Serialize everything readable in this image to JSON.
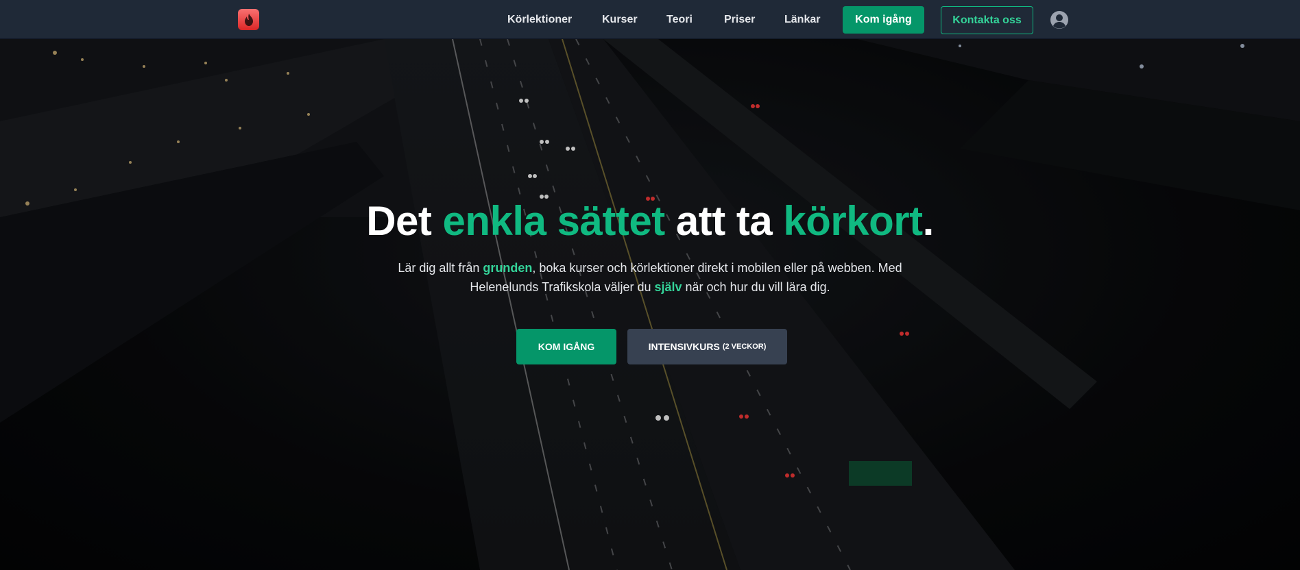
{
  "nav": {
    "logo_icon": "flame-icon",
    "links": [
      "Körlektioner",
      "Kurser",
      "Teori",
      "Priser",
      "Länkar"
    ],
    "primary_button": "Kom igång",
    "outline_button": "Kontakta oss",
    "avatar_icon": "user-circle-icon"
  },
  "hero": {
    "headline": {
      "p1": "Det ",
      "h1": "enkla sättet",
      "p2": " att ta ",
      "h2": "körkort",
      "p3": "."
    },
    "subtitle": {
      "p1": "Lär dig allt från ",
      "h1": "grunden",
      "p2": ", boka kurser och körlektioner direkt i mobilen eller på webben. Med Helenelunds Trafikskola väljer du ",
      "h2": "själv",
      "p3": " när och hur du vill lära dig."
    },
    "cta_primary": "KOM IGÅNG",
    "cta_secondary": "INTENSIVKURS",
    "cta_secondary_small": "(2 VECKOR)"
  },
  "colors": {
    "accent": "#10b981",
    "nav_bg": "#1f2937",
    "button_green": "#059669",
    "button_gray": "#374151"
  }
}
